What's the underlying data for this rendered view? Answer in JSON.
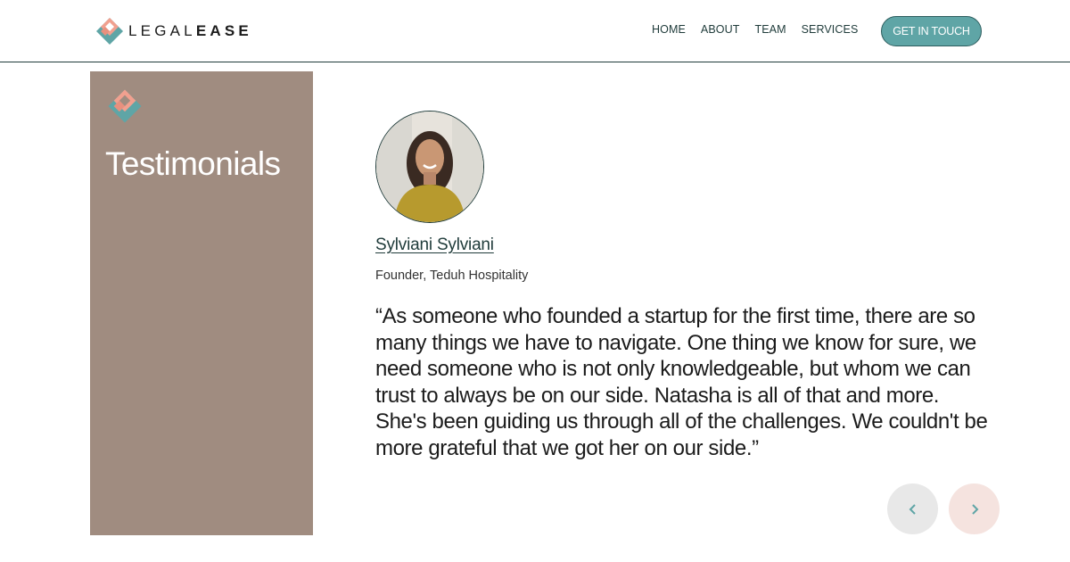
{
  "header": {
    "brand_light": "LEGAL",
    "brand_bold": "EASE",
    "nav": [
      "HOME",
      "ABOUT",
      "TEAM",
      "SERVICES"
    ],
    "cta_label": "GET IN TOUCH"
  },
  "panel": {
    "title": "Testimonials",
    "logo_icon": "legalease-logo-icon"
  },
  "testimonial": {
    "name": "Sylviani Sylviani",
    "role": "Founder, Teduh Hospitality",
    "quote": "“As someone who founded a startup for the first time, there are so many things we have to navigate. One thing we know for sure, we need someone who is not only knowledgeable, but whom we can trust to always be on our side. Natasha is all of that and more. She's been guiding us through all of the challenges. We couldn't be more grateful that we got her on our side.”"
  },
  "controls": {
    "prev_icon": "chevron-left-icon",
    "next_icon": "chevron-right-icon"
  },
  "colors": {
    "brand_teal": "#5fa5a6",
    "brand_coral": "#e8907e",
    "panel_bg": "#a08c80",
    "dark_text": "#1f3b3a"
  }
}
